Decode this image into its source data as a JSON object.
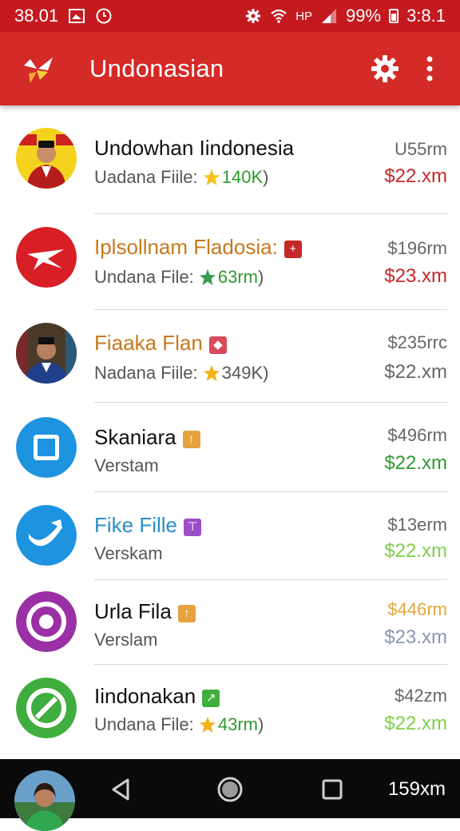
{
  "status_bar": {
    "time_left": "38.01",
    "network": "HP",
    "battery": "99%",
    "time_right": "3:8.1"
  },
  "app_bar": {
    "title": "Undonasian"
  },
  "items": [
    {
      "title": "Undowhan Iindonesia",
      "subtitle_prefix": "Uadana Fiile:",
      "subtitle_value": "140K",
      "subtitle_suffix": ")",
      "price_top": "U55rm",
      "price_bottom": "$22.xm",
      "title_color": "#111111",
      "value_color": "#2e9a2e",
      "price_bottom_color": "#c62828"
    },
    {
      "title": "Iplsollnam Fladosia:",
      "subtitle_prefix": "Undana File:",
      "subtitle_value": "63rm",
      "subtitle_suffix": ")",
      "price_top": "$196rm",
      "price_bottom": "$23.xm",
      "title_color": "#c8781e",
      "value_color": "#2e9a2e",
      "price_bottom_color": "#c62828"
    },
    {
      "title": "Fiaaka Flan",
      "subtitle_prefix": "Nadana Fiile:",
      "subtitle_value": "349K",
      "subtitle_suffix": ")",
      "price_top": "$235rrc",
      "price_bottom": "$22.xm",
      "title_color": "#c8781e",
      "value_color": "#555555",
      "price_bottom_color": "#c62828"
    },
    {
      "title": "Skaniara",
      "subtitle_prefix": "Verstam",
      "subtitle_value": "",
      "subtitle_suffix": "",
      "price_top": "$496rm",
      "price_bottom": "$22.xm",
      "title_color": "#111111",
      "value_color": "#555555",
      "price_bottom_color": "#2e9a2e"
    },
    {
      "title": "Fike Fille",
      "subtitle_prefix": "Verskam",
      "subtitle_value": "",
      "subtitle_suffix": "",
      "price_top": "$13erm",
      "price_bottom": "$22.xm",
      "title_color": "#2a8fc9",
      "value_color": "#555555",
      "price_bottom_color": "#7fcf4a"
    },
    {
      "title": "Urla Fila",
      "subtitle_prefix": "Verslam",
      "subtitle_value": "",
      "subtitle_suffix": "",
      "price_top": "$446rm",
      "price_bottom": "$23.xm",
      "title_color": "#111111",
      "value_color": "#555555",
      "price_top_color": "#e0a83a",
      "price_bottom_color": "#8a95b5"
    },
    {
      "title": "Iindonakan",
      "subtitle_prefix": "Undana File:",
      "subtitle_value": "43rm",
      "subtitle_suffix": ")",
      "price_top": "$42zm",
      "price_bottom": "$22.xm",
      "title_color": "#111111",
      "value_color": "#2e9a2e",
      "price_bottom_color": "#7fcf4a"
    }
  ],
  "nav_bar": {
    "right_text": "159xm"
  },
  "colors": {
    "status_bar": "#c41a1f",
    "app_bar": "#d42a28",
    "nav_bar": "#0a0a0a"
  }
}
